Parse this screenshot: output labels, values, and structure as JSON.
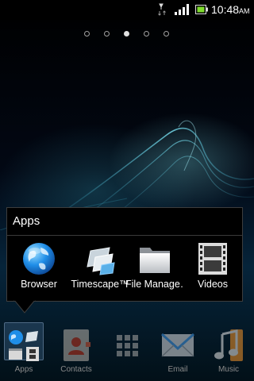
{
  "status_bar": {
    "time": "10:48",
    "time_suffix": "AM",
    "icons": [
      "usb-debug-icon",
      "signal-icon",
      "battery-icon"
    ],
    "battery_color": "#7fdc2e"
  },
  "home_pages": {
    "count": 5,
    "active_index": 2
  },
  "folder": {
    "title": "Apps",
    "apps": [
      {
        "label": "Browser",
        "icon": "globe-icon"
      },
      {
        "label": "Timescape™",
        "icon": "timescape-icon"
      },
      {
        "label": "File Manage…",
        "icon": "folder-icon"
      },
      {
        "label": "Videos",
        "icon": "film-icon"
      }
    ]
  },
  "dock": {
    "items": [
      {
        "label": "Apps",
        "icon": "apps-folder-icon",
        "active": true
      },
      {
        "label": "Contacts",
        "icon": "contacts-icon"
      },
      {
        "label": "",
        "icon": "app-drawer-icon"
      },
      {
        "label": "Email",
        "icon": "email-icon"
      },
      {
        "label": "Music",
        "icon": "music-icon"
      }
    ]
  },
  "colors": {
    "accent": "#4a90d9",
    "label_gray": "#8a8a8a"
  }
}
